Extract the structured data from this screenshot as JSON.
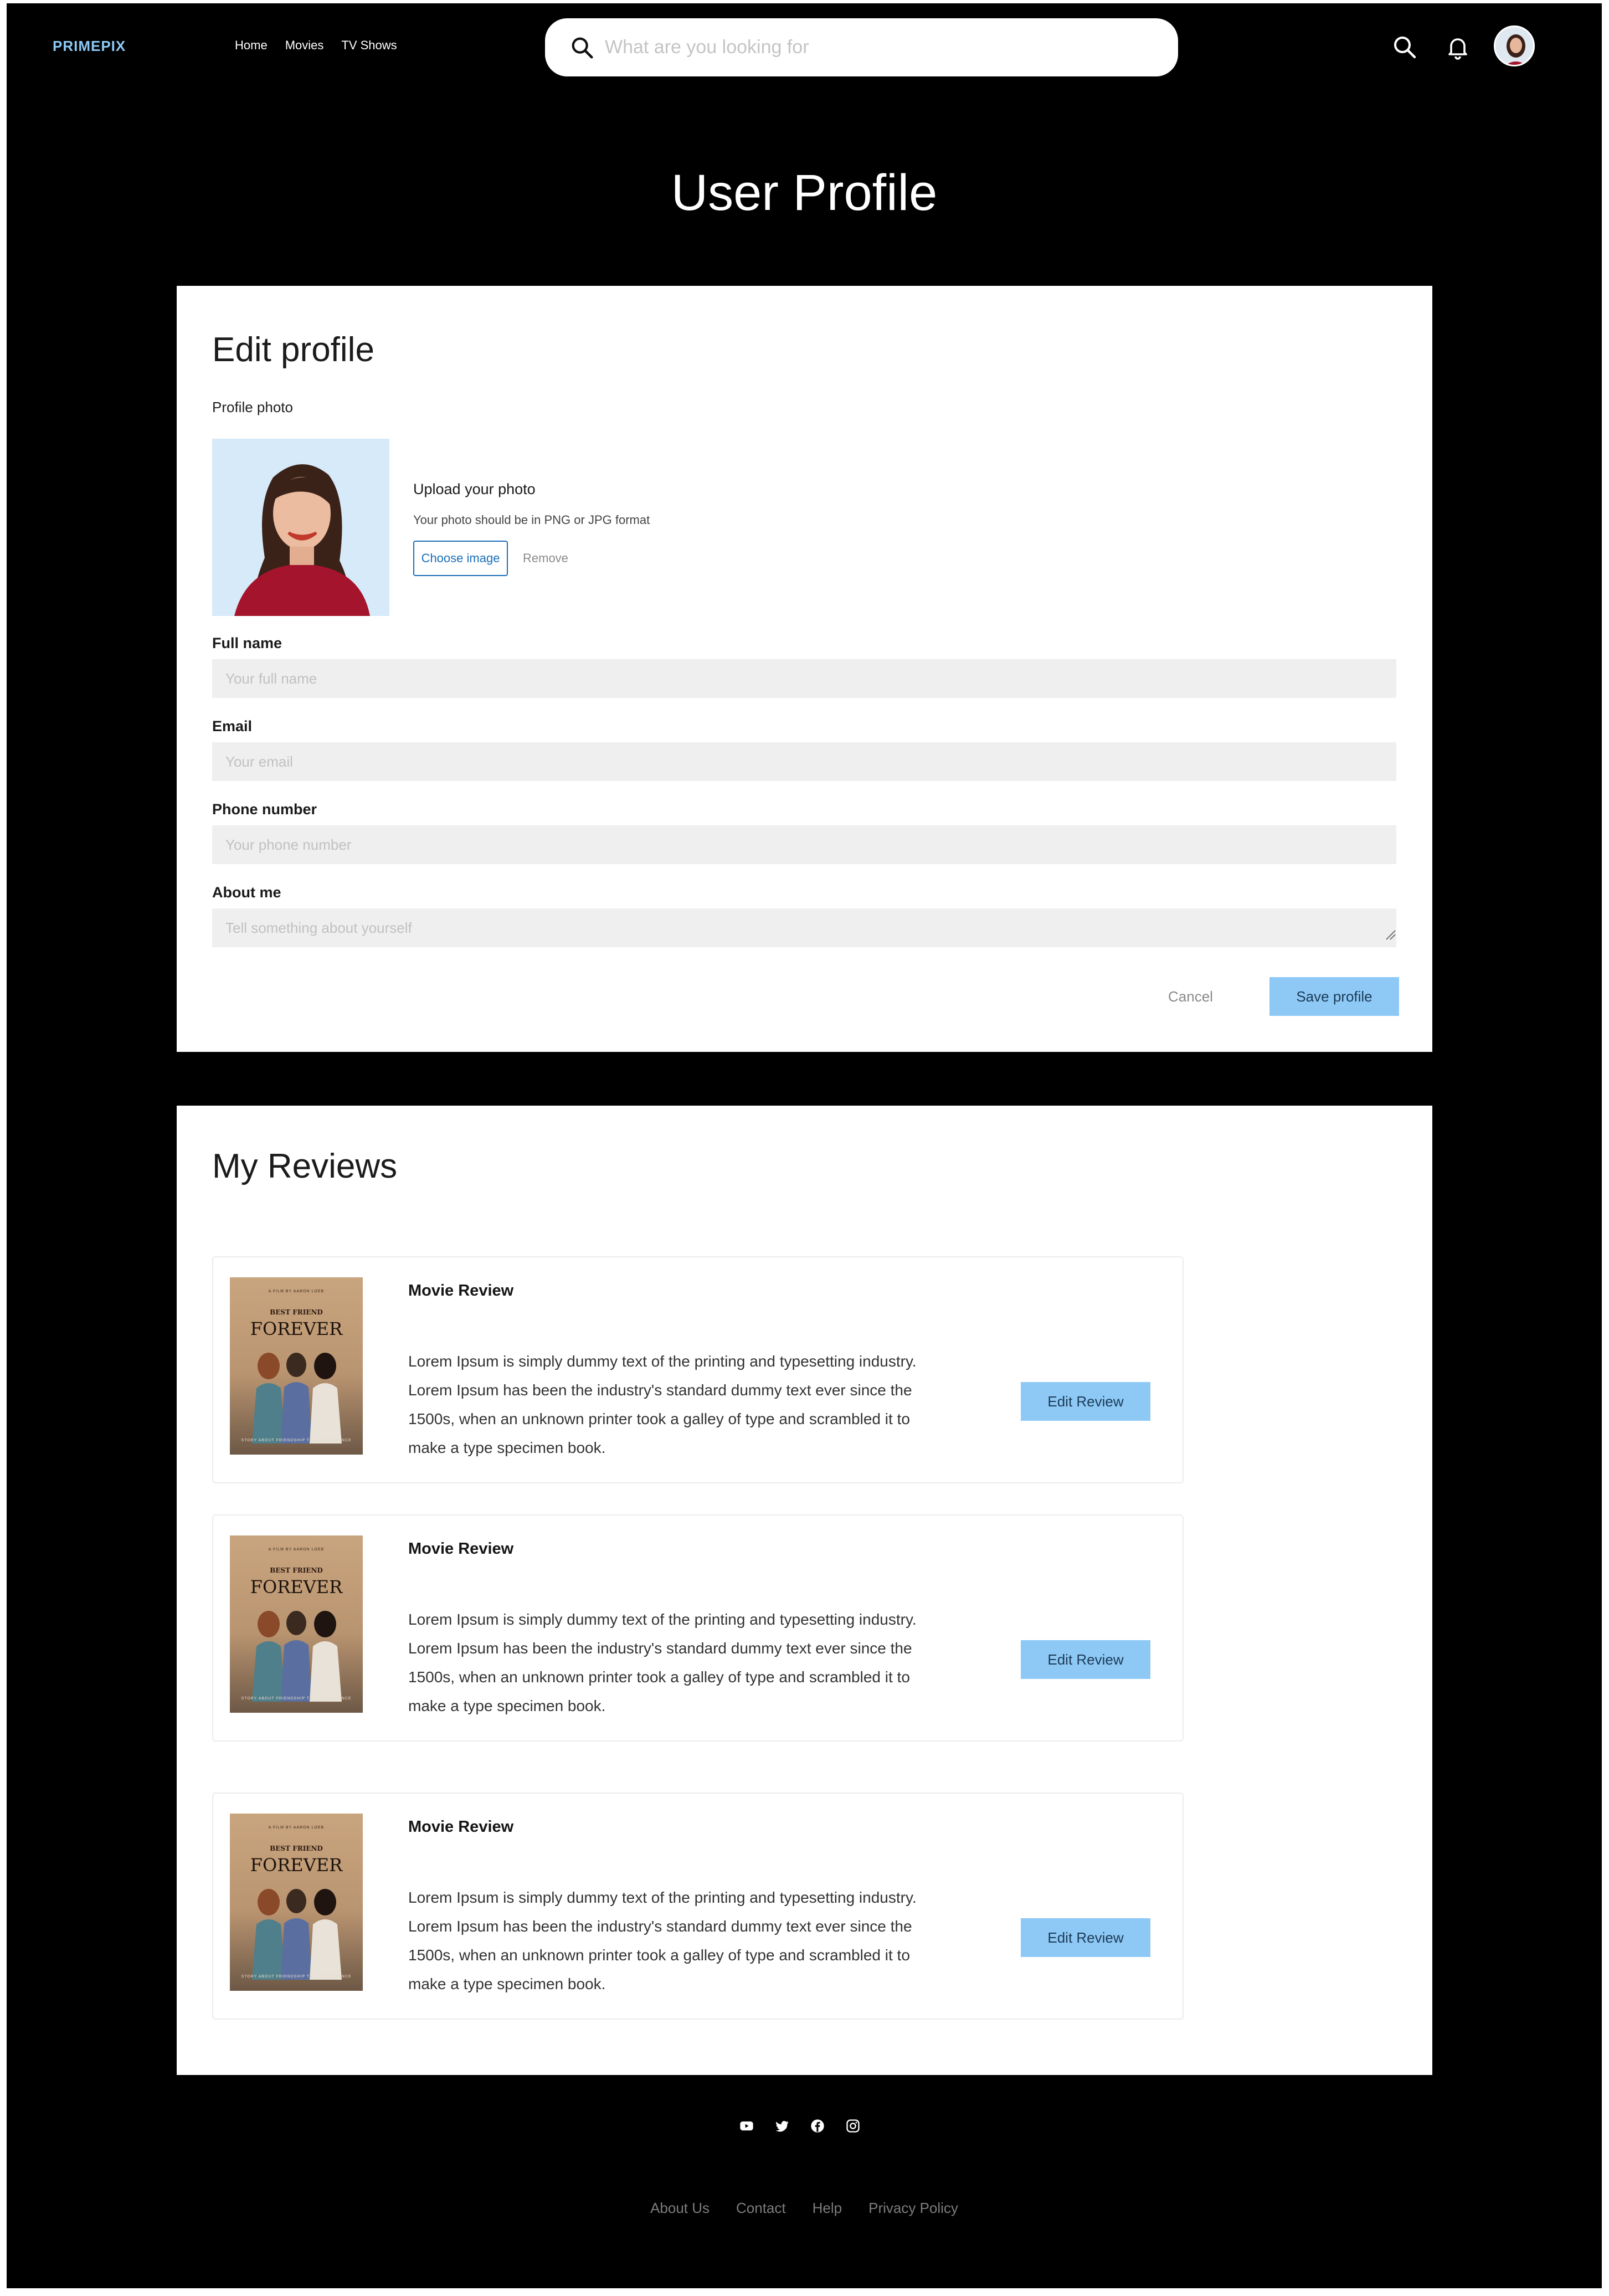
{
  "header": {
    "logo": "PRIMEPIX",
    "nav": [
      "Home",
      "Movies",
      "TV Shows"
    ],
    "search_placeholder": "What are you looking for",
    "icons": [
      "search-icon",
      "bell-icon",
      "avatar"
    ]
  },
  "page_title": "User Profile",
  "edit_profile": {
    "title": "Edit profile",
    "photo_label": "Profile photo",
    "upload_title": "Upload your photo",
    "upload_hint": "Your photo should be in PNG or JPG format",
    "choose_label": "Choose image",
    "remove_label": "Remove",
    "fields": [
      {
        "label": "Full name",
        "placeholder": "Your full name"
      },
      {
        "label": "Email",
        "placeholder": "Your email"
      },
      {
        "label": "Phone number",
        "placeholder": "Your phone number"
      },
      {
        "label": "About me",
        "placeholder": "Tell something about yourself"
      }
    ],
    "cancel_label": "Cancel",
    "save_label": "Save profile"
  },
  "reviews": {
    "title": "My Reviews",
    "items": [
      {
        "heading": "Movie Review",
        "text": "Lorem Ipsum is simply dummy text of the printing and typesetting industry. Lorem Ipsum has been the industry's standard dummy text ever since the 1500s, when an unknown printer took a galley of type and scrambled it to make a type specimen book.",
        "button": "Edit Review",
        "poster": {
          "top": "A FILM BY AARON LOEB",
          "sub": "BEST FRIEND",
          "main": "FOREVER",
          "bottom": "STORY ABOUT FRIENDSHIP TELL OF ROMANCE"
        }
      },
      {
        "heading": "Movie Review",
        "text": "Lorem Ipsum is simply dummy text of the printing and typesetting industry. Lorem Ipsum has been the industry's standard dummy text ever since the 1500s, when an unknown printer took a galley of type and scrambled it to make a type specimen book.",
        "button": "Edit Review",
        "poster": {
          "top": "A FILM BY AARON LOEB",
          "sub": "BEST FRIEND",
          "main": "FOREVER",
          "bottom": "STORY ABOUT FRIENDSHIP TELL OF ROMANCE"
        }
      },
      {
        "heading": "Movie Review",
        "text": "Lorem Ipsum is simply dummy text of the printing and typesetting industry. Lorem Ipsum has been the industry's standard dummy text ever since the 1500s, when an unknown printer took a galley of type and scrambled it to make a type specimen book.",
        "button": "Edit Review",
        "poster": {
          "top": "A FILM BY AARON LOEB",
          "sub": "BEST FRIEND",
          "main": "FOREVER",
          "bottom": "STORY ABOUT FRIENDSHIP TELL OF ROMANCE"
        }
      }
    ]
  },
  "footer": {
    "social_icons": [
      "youtube-icon",
      "twitter-icon",
      "facebook-icon",
      "instagram-icon"
    ],
    "links": [
      "About Us",
      "Contact",
      "Help",
      "Privacy Policy"
    ]
  },
  "colors": {
    "background": "#000000",
    "accent": "#8ec9f6",
    "logo": "#8cc8f5",
    "link_blue": "#1a6fb8"
  }
}
